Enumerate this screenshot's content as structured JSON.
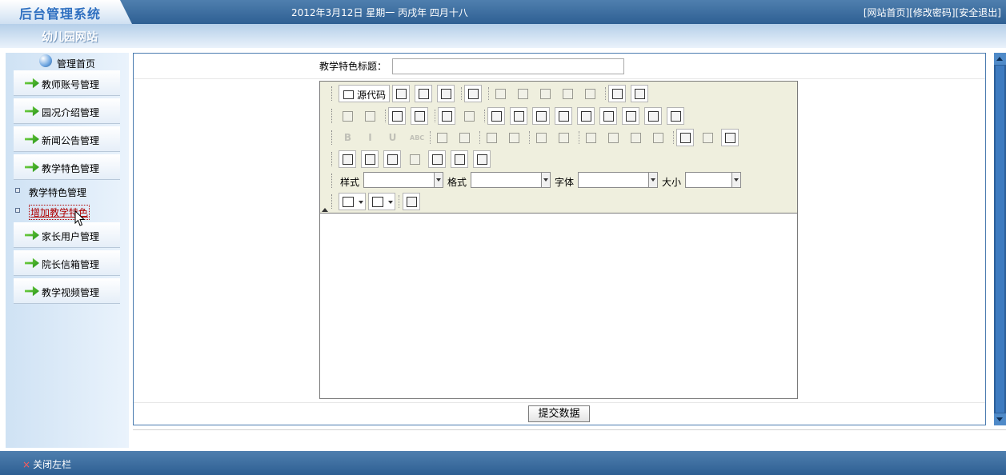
{
  "header": {
    "logo": "后台管理系统",
    "date": "2012年3月12日 星期一 丙戌年 四月十八",
    "links": [
      "[网站首页]",
      "[修改密码]",
      "[安全退出]"
    ],
    "site_name": "幼儿园网站"
  },
  "sidebar": {
    "home": "管理首页",
    "menu_top": [
      "教师账号管理",
      "园况介绍管理",
      "新闻公告管理",
      "教学特色管理"
    ],
    "submenu": [
      "教学特色管理",
      "增加教学特色"
    ],
    "menu_bottom": [
      "家长用户管理",
      "院长信箱管理",
      "教学视频管理"
    ]
  },
  "form": {
    "title_label": "教学特色标题：",
    "title_value": "",
    "submit": "提交数据"
  },
  "ckeditor": {
    "source_label": "源代码",
    "dropdowns": [
      "样式",
      "格式",
      "字体",
      "大小"
    ],
    "rows": [
      [
        "save-icon",
        "new-page-icon",
        "preview-icon",
        "|",
        "templates-icon",
        "|",
        "cut-icon",
        "copy-icon",
        "paste-icon",
        "paste-text-icon",
        "paste-word-icon",
        "|",
        "print-icon",
        "spellcheck-icon"
      ],
      [
        "undo-icon",
        "redo-icon",
        "|",
        "find-icon",
        "replace-icon",
        "|",
        "select-all-icon",
        "remove-format-icon",
        "|",
        "form-icon",
        "checkbox-icon",
        "radio-icon",
        "textfield-icon",
        "textarea-icon",
        "select-field-icon",
        "button-icon",
        "image-button-icon",
        "hidden-field-icon"
      ],
      [
        "bold-icon",
        "italic-icon",
        "underline-icon",
        "strike-icon",
        "|",
        "subscript-icon",
        "superscript-icon",
        "|",
        "numbered-list-icon",
        "bulleted-list-icon",
        "|",
        "outdent-icon",
        "indent-icon",
        "|",
        "align-left-icon",
        "align-center-icon",
        "align-right-icon",
        "justify-icon",
        "|",
        "link-icon",
        "unlink-icon",
        "anchor-icon"
      ],
      [
        "image-icon",
        "flash-icon",
        "table-icon",
        "horizontal-rule-icon",
        "smiley-icon",
        "special-char-icon",
        "page-break-icon"
      ]
    ],
    "combos": [
      "text-color-icon",
      "background-color-icon",
      "maximize-icon"
    ]
  },
  "footer": {
    "close_sidebar": "关闭左栏"
  },
  "colors": {
    "header": "#2e5f93",
    "accent": "#4a7bb0",
    "toolbar_bg": "#efefde",
    "active_submenu": "#b00000"
  }
}
